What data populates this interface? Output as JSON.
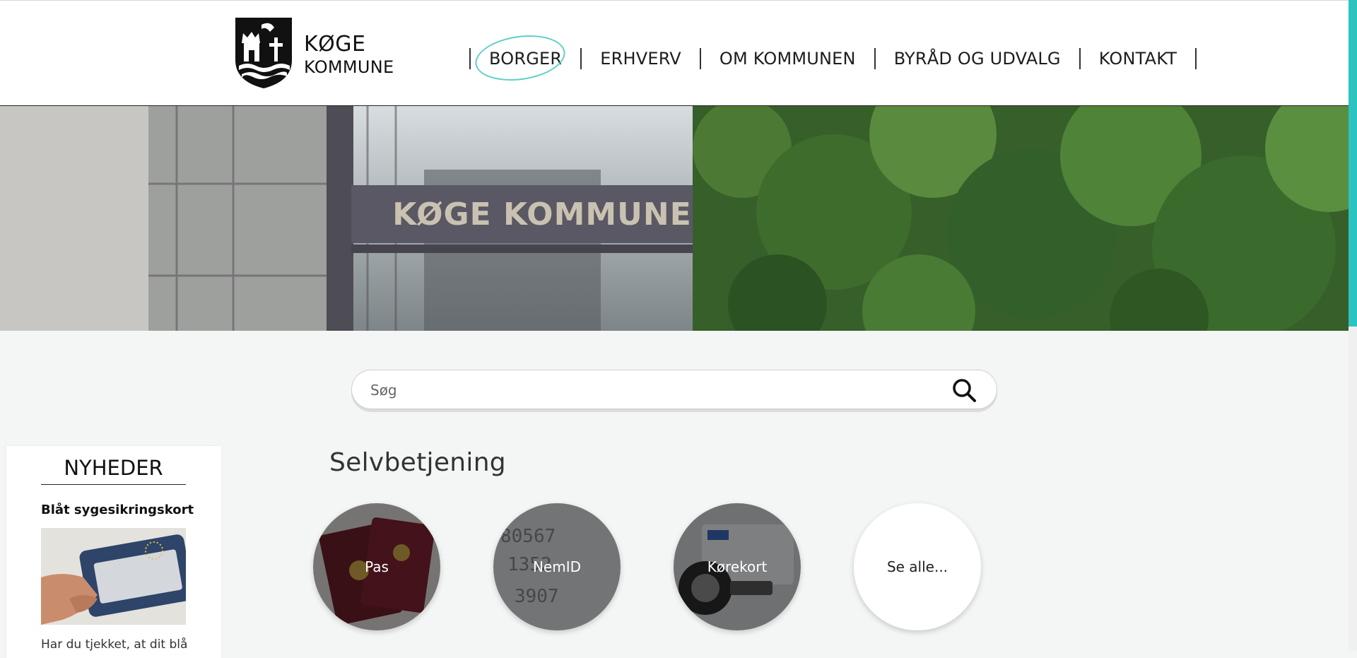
{
  "header": {
    "logo_line1": "KØGE",
    "logo_line2": "KOMMUNE",
    "nav": [
      {
        "label": "BORGER",
        "active": true
      },
      {
        "label": "ERHVERV",
        "active": false
      },
      {
        "label": "OM KOMMUNEN",
        "active": false
      },
      {
        "label": "BYRÅD OG UDVALG",
        "active": false
      },
      {
        "label": "KONTAKT",
        "active": false
      }
    ]
  },
  "hero": {
    "sign_text": "KØGE KOMMUNE"
  },
  "search": {
    "placeholder": "Søg"
  },
  "news": {
    "title": "NYHEDER",
    "item_title": "Blåt sygesikringskort",
    "item_text": "Har du tjekket, at dit blå"
  },
  "selfservice": {
    "title": "Selvbetjening",
    "tiles": [
      {
        "label": "Pas"
      },
      {
        "label": "NemID"
      },
      {
        "label": "Kørekort"
      },
      {
        "label": "Se alle..."
      }
    ]
  },
  "colors": {
    "accent": "#2cc3c0",
    "nav_highlight": "#5fcfc8",
    "page_bg": "#f3f6f5"
  },
  "icons": [
    "crest-logo-icon",
    "search-icon"
  ]
}
